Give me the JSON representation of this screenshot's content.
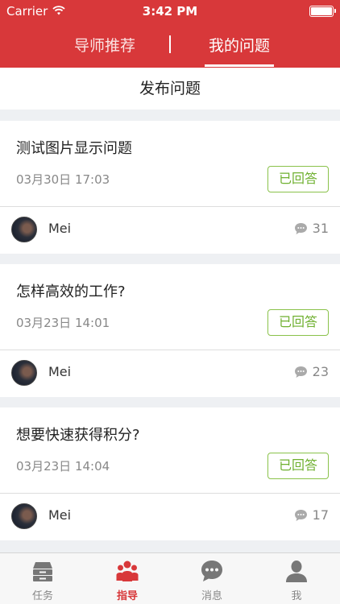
{
  "status_bar": {
    "carrier": "Carrier",
    "time": "3:42 PM"
  },
  "top_tabs": {
    "left": "导师推荐",
    "right": "我的问题",
    "active": "我的问题"
  },
  "publish": {
    "label": "发布问题"
  },
  "questions": [
    {
      "title": "测试图片显示问题",
      "time": "03月30日 17:03",
      "status": "已回答",
      "user": "Mei",
      "comments": "31"
    },
    {
      "title": "怎样高效的工作?",
      "time": "03月23日 14:01",
      "status": "已回答",
      "user": "Mei",
      "comments": "23"
    },
    {
      "title": "想要快速获得积分?",
      "time": "03月23日 14:04",
      "status": "已回答",
      "user": "Mei",
      "comments": "17"
    }
  ],
  "tabbar": {
    "items": [
      {
        "label": "任务",
        "icon": "drawer-icon"
      },
      {
        "label": "指导",
        "icon": "group-icon"
      },
      {
        "label": "消息",
        "icon": "chat-bubble-icon"
      },
      {
        "label": "我",
        "icon": "person-icon"
      }
    ],
    "active": "指导"
  },
  "colors": {
    "brand_red": "#d8383a",
    "answered_green": "#6fb030"
  }
}
